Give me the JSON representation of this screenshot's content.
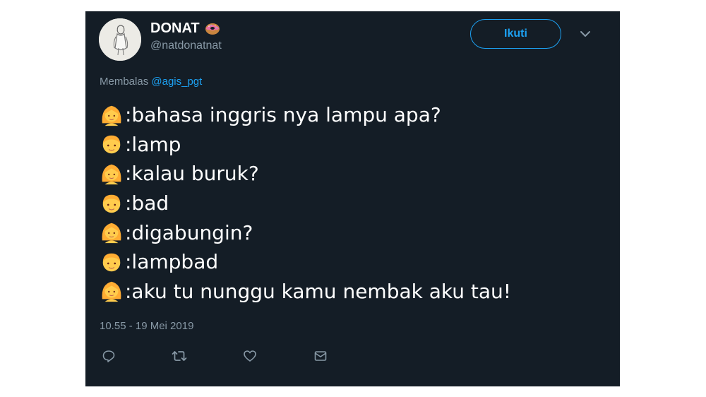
{
  "author": {
    "display_name": "DONAT",
    "handle": "@natdonatnat",
    "name_emoji_icon": "doughnut-icon",
    "avatar_icon": "profile-avatar"
  },
  "follow_button": {
    "label": "Ikuti"
  },
  "menu_icon": "chevron-down-icon",
  "reply_context": {
    "prefix": "Membalas",
    "mention": "@agis_pgt"
  },
  "tweet_lines": [
    {
      "speaker": "girl",
      "text": ":bahasa inggris nya lampu apa?"
    },
    {
      "speaker": "boy",
      "text": ":lamp"
    },
    {
      "speaker": "girl",
      "text": ":kalau buruk?"
    },
    {
      "speaker": "boy",
      "text": ":bad"
    },
    {
      "speaker": "girl",
      "text": ":digabungin?"
    },
    {
      "speaker": "boy",
      "text": ":lampbad"
    },
    {
      "speaker": "girl",
      "text": ":aku tu nunggu kamu nembak aku tau!"
    }
  ],
  "timestamp": "10.55 - 19 Mei 2019",
  "actions": [
    "reply-icon",
    "retweet-icon",
    "like-icon",
    "direct-message-icon"
  ],
  "colors": {
    "background": "#141d26",
    "text": "#ffffff",
    "secondary_text": "#8899a6",
    "accent": "#1da1f2"
  }
}
